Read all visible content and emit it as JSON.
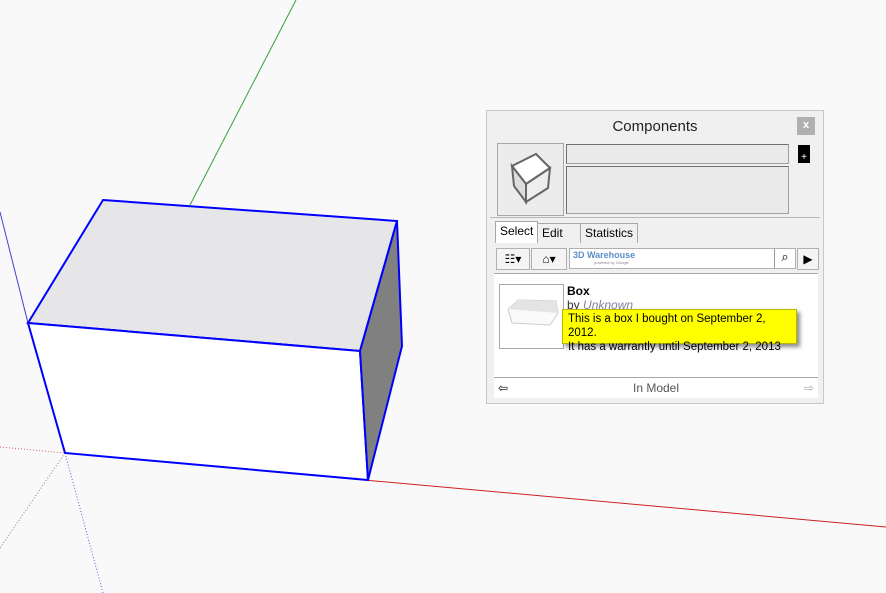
{
  "panel": {
    "title": "Components",
    "close": "x",
    "tabs": [
      "Select",
      "Edit",
      "Statistics"
    ],
    "search": {
      "logo": "3D Warehouse",
      "logo_sub": "powered by Google",
      "icon": "search-icon"
    },
    "item": {
      "name": "Box",
      "by": "by",
      "author": "Unknown"
    },
    "tooltip": {
      "line1": "This is a box I bought on September 2, 2012.",
      "line2": "It has a warrantly until September 2, 2013"
    },
    "footer": {
      "label": "In Model"
    }
  },
  "colors": {
    "selection": "#0000ff",
    "x_axis": "#d00000",
    "y_axis": "#00a000",
    "tooltip": "#ffff00"
  }
}
